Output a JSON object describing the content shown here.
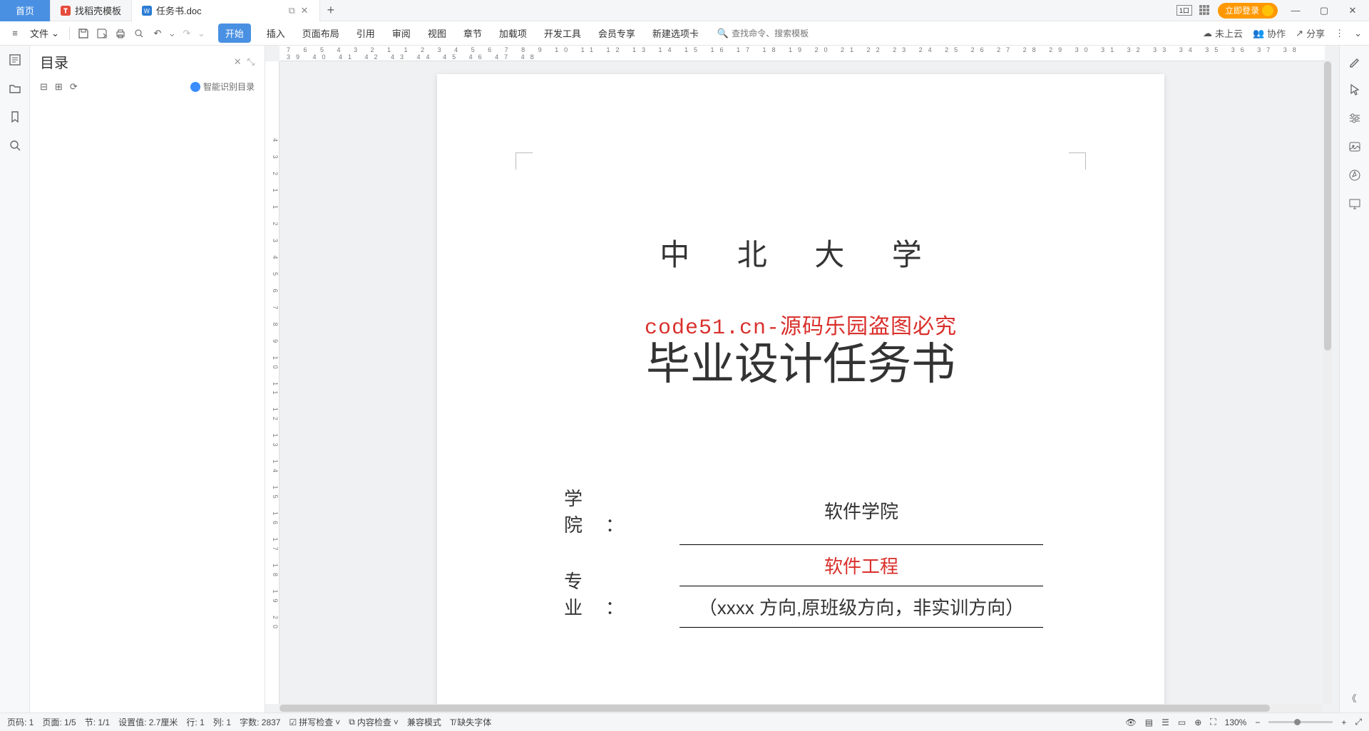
{
  "tabs": {
    "home": "首页",
    "template": "找稻壳模板",
    "doc": "任务书.doc"
  },
  "login_label": "立即登录",
  "file_menu": "文件",
  "ribbon": {
    "start": "开始",
    "insert": "插入",
    "layout": "页面布局",
    "reference": "引用",
    "review": "审阅",
    "view": "视图",
    "chapter": "章节",
    "addon": "加载项",
    "devtool": "开发工具",
    "member": "会员专享",
    "newtab": "新建选项卡"
  },
  "search_placeholder": "查找命令、搜索模板",
  "topright": {
    "cloud": "未上云",
    "collab": "协作",
    "share": "分享"
  },
  "hruler_text": "7 6 5 4 3 2 1   1 2 3 4 5 6 7 8 9 10 11 12 13 14 15 16 17 18 19 20 21 22 23 24 25 26 27 28 29 30 31 32 33 34 35 36 37 38 39 40 41 42 43 44 45 46 47 48",
  "vruler_text": "4 3 2 1 1 2 3 4 5 6 7 8 9 10 11 12 13 14 15 16 17 18 19 20",
  "toc": {
    "title": "目录",
    "smart": "智能识别目录"
  },
  "document": {
    "university": "中 北 大 学",
    "watermark": "code51.cn-源码乐园盗图必究",
    "title": "毕业设计任务书",
    "rows": [
      {
        "label": "学院：",
        "lines": [
          {
            "text": "软件学院",
            "red": false
          }
        ]
      },
      {
        "label": "专业：",
        "lines": [
          {
            "text": "软件工程",
            "red": true
          },
          {
            "text": "（xxxx 方向,原班级方向，非实训方向）",
            "red": false
          }
        ]
      }
    ]
  },
  "status": {
    "page_code": "页码: 1",
    "page": "页面: 1/5",
    "section": "节: 1/1",
    "setvalue": "设置值: 2.7厘米",
    "row": "行: 1",
    "col": "列: 1",
    "words": "字数: 2837",
    "spell": "拼写检查",
    "content": "内容检查",
    "compat": "兼容模式",
    "missingfont": "缺失字体",
    "zoom": "130%"
  }
}
